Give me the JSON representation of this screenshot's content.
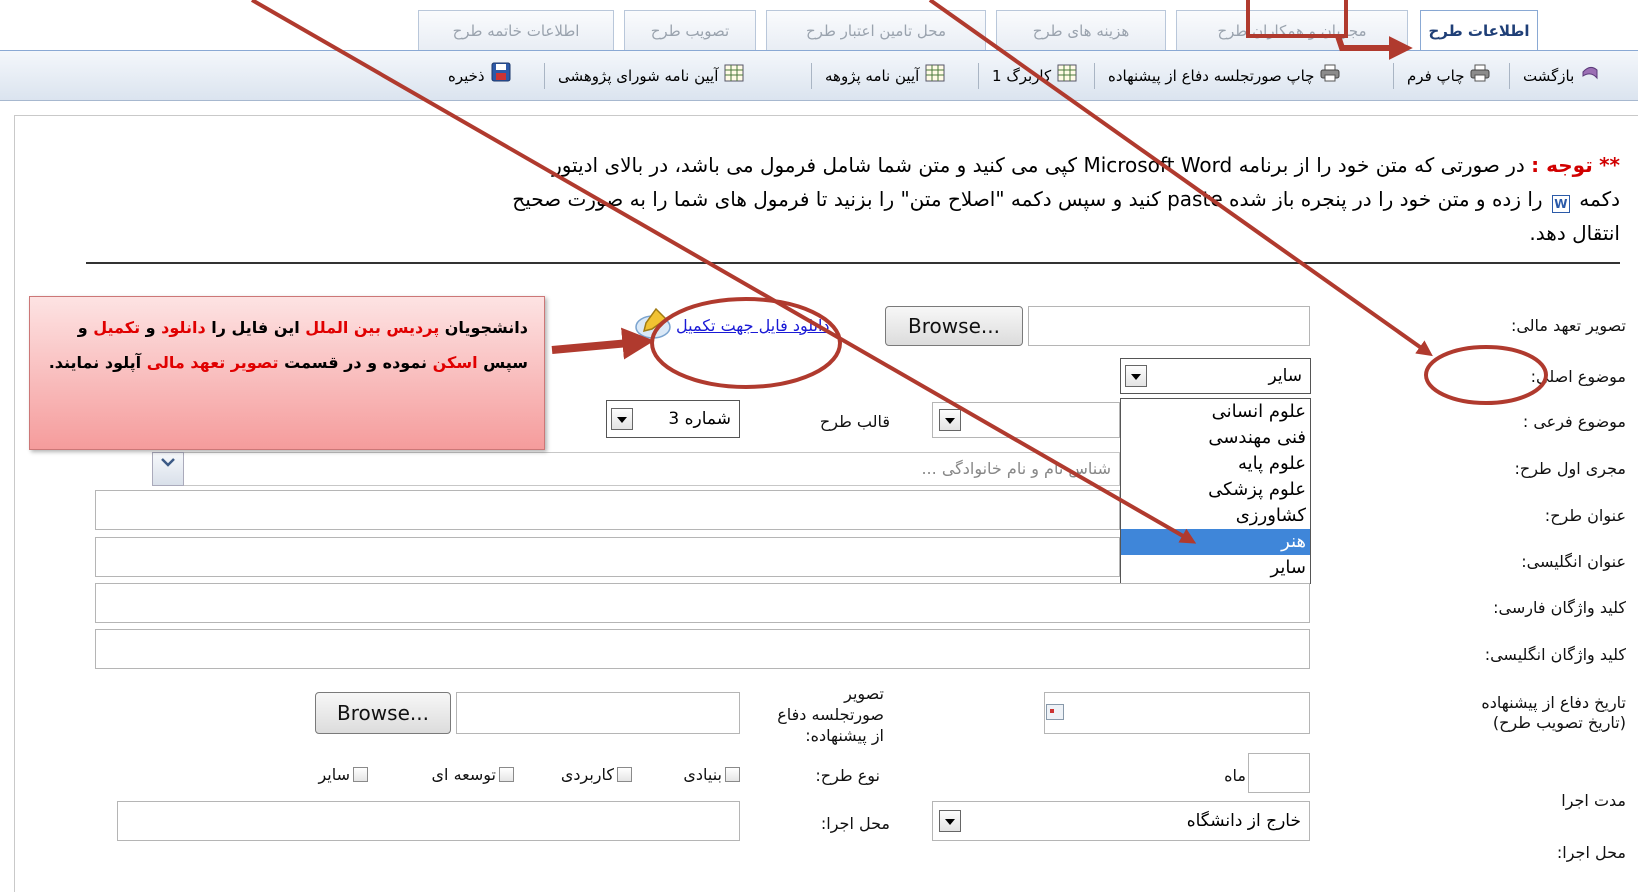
{
  "tabs": [
    {
      "label": "اطلاعات طرح",
      "active": true
    },
    {
      "label": "مجریان و همکاران طرح"
    },
    {
      "label": "هزینه های طرح"
    },
    {
      "label": "محل تامین اعتبار طرح"
    },
    {
      "label": "تصویب طرح"
    },
    {
      "label": "اطلاعات خاتمه طرح"
    }
  ],
  "toolbar": {
    "back": "بازگشت",
    "print_form": "چاپ فرم",
    "print_minutes": "چاپ صورتجلسه دفاع از پیشنهاده",
    "worksheet1": "کاربرگ 1",
    "research_regulation": "آیین نامه پژوهه",
    "research_council_regulation": "آیین نامه شورای پژوهشی",
    "save": "ذخیره"
  },
  "notice": {
    "stars": "**",
    "title": "توجه :",
    "line1": "در صورتی که متن خود را از برنامه Microsoft Word کپی می کنید و متن شما شامل فرمول می باشد، در بالای ادیتور",
    "line2a": "دکمه",
    "line2b": "را زده و متن خود را در پنجره باز شده paste کنید و سپس دکمه \"اصلاح متن\" را بزنید تا فرمول های شما را به صورت صحیح",
    "line3": "انتقال دهد."
  },
  "form": {
    "financial_label": "تصویر تعهد مالی:",
    "browse": "Browse...",
    "download_link": "دانلود فایل جهت تکمیل",
    "main_subject_label": "موضوع اصلی:",
    "main_subject_value": "سایر",
    "sub_subject_label": "موضوع فرعی :",
    "template_label": "قالب طرح",
    "template_value": "شماره 3",
    "first_executor_label": "مجری اول طرح:",
    "executor_placeholder": "شناس نام و نام خانوادگی ...",
    "title_label": "عنوان طرح:",
    "english_title_label": "عنوان انگلیسی:",
    "fa_keywords_label": "کلید واژگان فارسی:",
    "en_keywords_label": "کلید واژگان انگلیسی:",
    "defense_date_label_1": "تاریخ دفاع از پیشنهاده",
    "defense_date_label_2": "(تاریخ تصویب طرح)",
    "minutes_image_label_1": "تصویر",
    "minutes_image_label_2": "صورتجلسه دفاع",
    "minutes_image_label_3": "از پیشنهاده:",
    "duration_label": "مدت اجرا",
    "month": "ماه",
    "project_type_label": "نوع طرح:",
    "types": [
      "بنیادی",
      "کاربردی",
      "توسعه ای",
      "سایر"
    ],
    "location_label": "محل اجرا:",
    "location_value": "خارج از دانشگاه",
    "location_label_2": "محل اجرا:"
  },
  "subject_options": [
    "علوم انسانی",
    "فنی مهندسی",
    "علوم پایه",
    "علوم پزشکی",
    "کشاورزی",
    "هنر",
    "سایر"
  ],
  "callout": {
    "p1": "دانشجویان ",
    "p2": "پردیس بین الملل",
    "p3": " این فایل را ",
    "p4": "دانلود",
    "p5": " و ",
    "p6": "تکمیل",
    "p7": " و سپس ",
    "p8": "اسکن",
    "p9": " نموده و در قسمت ",
    "p10": "تصویر تعهد مالی",
    "p11": " آپلود نمایند."
  },
  "colors": {
    "annotation": "#c0392b",
    "active_tab": "#1f3f77",
    "highlight": "#3f86d9"
  }
}
